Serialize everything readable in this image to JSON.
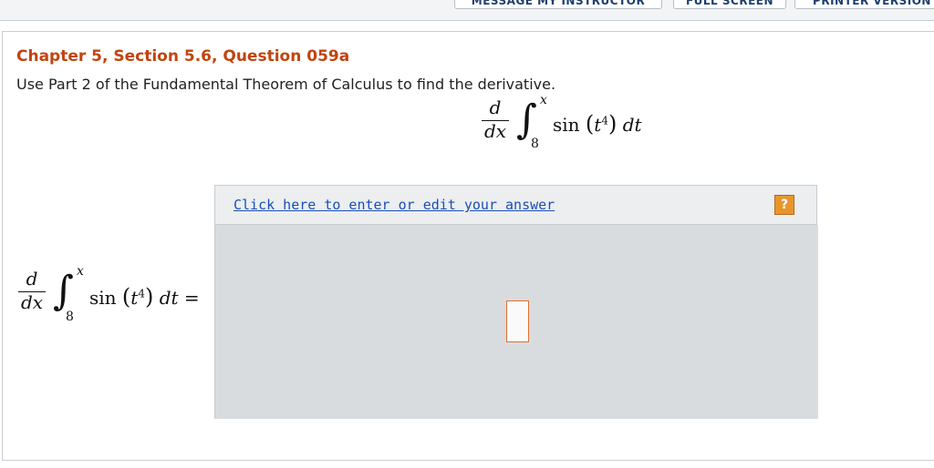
{
  "toolbar": {
    "message_label": "MESSAGE MY INSTRUCTOR",
    "fullscreen_label": "FULL SCREEN",
    "printer_label": "PRINTER VERSION"
  },
  "question": {
    "chapter": "Chapter 5, Section 5.6, Question 059a",
    "prompt": "Use Part 2 of the Fundamental Theorem of Calculus to find the derivative."
  },
  "expression": {
    "numerator": "d",
    "denominator": "dx",
    "integral_sign": "∫",
    "upper_limit": "x",
    "lower_limit": "8",
    "func": "sin",
    "var": "t",
    "exponent": "4",
    "differential": "dt",
    "equals": "="
  },
  "answer": {
    "link_label": "Click here to enter or edit your answer",
    "help_label": "?"
  },
  "colors": {
    "chapter_title": "#c1440e",
    "link": "#1a4fb5",
    "help_button": "#e8962c",
    "answer_box_border": "#e07030"
  }
}
